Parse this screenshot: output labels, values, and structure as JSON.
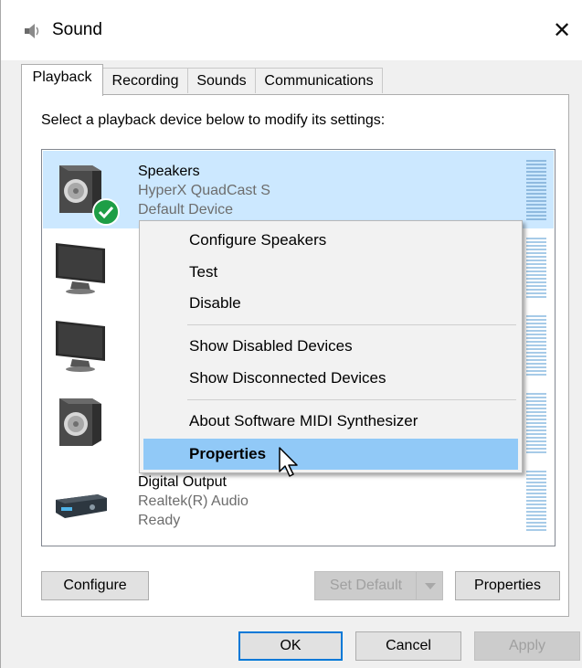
{
  "window": {
    "title": "Sound",
    "close_glyph": "✕",
    "app_icon": "speaker-icon"
  },
  "tabs": [
    {
      "label": "Playback",
      "active": true
    },
    {
      "label": "Recording",
      "active": false
    },
    {
      "label": "Sounds",
      "active": false
    },
    {
      "label": "Communications",
      "active": false
    }
  ],
  "instruction": "Select a playback device below to modify its settings:",
  "devices": [
    {
      "name": "Speakers",
      "sub": "HyperX QuadCast S",
      "status": "Default Device",
      "icon": "speaker-icon",
      "selected": true,
      "default_badge": true
    },
    {
      "name": "",
      "sub": "",
      "status": "",
      "icon": "monitor-icon",
      "selected": false
    },
    {
      "name": "",
      "sub": "",
      "status": "",
      "icon": "monitor-icon",
      "selected": false
    },
    {
      "name": "",
      "sub": "",
      "status": "",
      "icon": "speaker-icon",
      "selected": false
    },
    {
      "name": "Digital Output",
      "sub": "Realtek(R) Audio",
      "status": "Ready",
      "icon": "receiver-icon",
      "selected": false
    }
  ],
  "context_menu": {
    "items": [
      {
        "label": "Configure Speakers"
      },
      {
        "label": "Test"
      },
      {
        "label": "Disable"
      },
      {
        "label": "Show Disabled Devices"
      },
      {
        "label": "Show Disconnected Devices"
      },
      {
        "label": "About Software MIDI Synthesizer"
      },
      {
        "label": "Properties",
        "bold": true,
        "hovered": true
      }
    ]
  },
  "buttons": {
    "configure": "Configure",
    "set_default": "Set Default",
    "properties": "Properties",
    "ok": "OK",
    "cancel": "Cancel",
    "apply": "Apply"
  },
  "colors": {
    "selection": "#cce8ff",
    "menu_hover": "#91c9f7",
    "default_check": "#1e9e46",
    "accent": "#0078d7"
  }
}
